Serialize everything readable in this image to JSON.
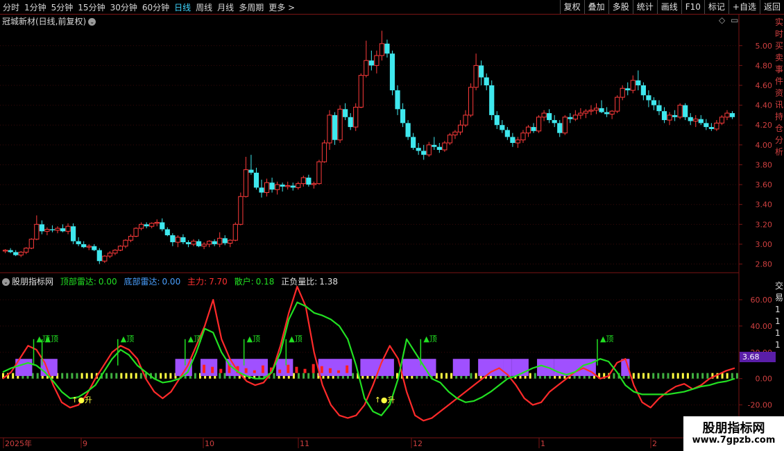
{
  "toolbar": {
    "periods": [
      "分时",
      "1分钟",
      "5分钟",
      "15分钟",
      "30分钟",
      "60分钟",
      "日线",
      "周线",
      "月线",
      "多周期",
      "更多 >"
    ],
    "active_period": "日线",
    "buttons": [
      "复权",
      "叠加",
      "多股",
      "统计",
      "画线",
      "F10",
      "标记",
      "+自选",
      "返回"
    ]
  },
  "stock": {
    "title": "冠城新材(日线,前复权)"
  },
  "indicator": {
    "name": "股朋指标网",
    "top_radar_label": "顶部雷达:",
    "top_radar_value": "0.00",
    "bottom_radar_label": "底部雷达:",
    "bottom_radar_value": "0.00",
    "main_label": "主力:",
    "main_value": "7.70",
    "retail_label": "散户:",
    "retail_value": "0.18",
    "ratio_label": "正负量比:",
    "ratio_value": "1.38",
    "current_value_tag": "3.68",
    "signal_top": "▲顶",
    "signal_rise": "↑●升"
  },
  "right_strip_text": "实时买卖 事件 资讯 持仓 分析",
  "right_strip_lower": "交易1111",
  "watermark": {
    "line1": "股朋指标网",
    "line2": "www.7gpzb.com"
  },
  "colors": {
    "up": "#ff3b3b",
    "down": "#3fe8ee",
    "main": "#ff2a2a",
    "retail": "#22e022",
    "block": "#a050ff",
    "bar_yellow": "#ffff40",
    "bar_green": "#40b040",
    "axis": "#7a1414",
    "tick_label": "#d04040"
  },
  "chart_data": [
    {
      "type": "candlestick",
      "title": "冠城新材(日线,前复权)",
      "ylim": [
        2.72,
        5.18
      ],
      "y_ticks": [
        "5.00",
        "4.80",
        "4.60",
        "4.40",
        "4.20",
        "4.00",
        "3.80",
        "3.60",
        "3.40",
        "3.20",
        "3.00",
        "2.80"
      ],
      "x_labels": [
        "2025年",
        "9",
        "10",
        "11",
        "12",
        "1",
        "2"
      ],
      "candles": [
        [
          2.93,
          2.95,
          2.91,
          2.94
        ],
        [
          2.94,
          2.96,
          2.91,
          2.92
        ],
        [
          2.92,
          2.94,
          2.88,
          2.89
        ],
        [
          2.89,
          2.93,
          2.87,
          2.92
        ],
        [
          2.92,
          2.97,
          2.9,
          2.96
        ],
        [
          2.96,
          3.06,
          2.95,
          3.05
        ],
        [
          3.05,
          3.29,
          3.04,
          3.2
        ],
        [
          3.2,
          3.24,
          3.1,
          3.13
        ],
        [
          3.13,
          3.17,
          3.09,
          3.15
        ],
        [
          3.15,
          3.19,
          3.12,
          3.14
        ],
        [
          3.14,
          3.18,
          3.11,
          3.16
        ],
        [
          3.16,
          3.2,
          3.12,
          3.13
        ],
        [
          3.13,
          3.21,
          3.1,
          3.18
        ],
        [
          3.18,
          3.21,
          3.0,
          3.03
        ],
        [
          3.03,
          3.07,
          2.98,
          3.0
        ],
        [
          3.0,
          3.03,
          2.96,
          2.97
        ],
        [
          2.97,
          3.0,
          2.94,
          2.98
        ],
        [
          2.98,
          3.0,
          2.93,
          2.94
        ],
        [
          2.94,
          2.96,
          2.8,
          2.83
        ],
        [
          2.83,
          2.89,
          2.81,
          2.88
        ],
        [
          2.88,
          2.93,
          2.86,
          2.91
        ],
        [
          2.91,
          2.95,
          2.89,
          2.94
        ],
        [
          2.94,
          2.99,
          2.93,
          2.98
        ],
        [
          2.98,
          3.05,
          2.96,
          3.04
        ],
        [
          3.04,
          3.1,
          3.02,
          3.08
        ],
        [
          3.08,
          3.17,
          3.07,
          3.16
        ],
        [
          3.16,
          3.22,
          3.14,
          3.2
        ],
        [
          3.2,
          3.22,
          3.16,
          3.18
        ],
        [
          3.18,
          3.22,
          3.16,
          3.21
        ],
        [
          3.21,
          3.25,
          3.18,
          3.22
        ],
        [
          3.22,
          3.26,
          3.13,
          3.15
        ],
        [
          3.15,
          3.17,
          3.08,
          3.09
        ],
        [
          3.09,
          3.11,
          2.98,
          3.02
        ],
        [
          3.02,
          3.09,
          2.97,
          3.07
        ],
        [
          3.07,
          3.1,
          3.0,
          3.02
        ],
        [
          3.02,
          3.04,
          2.97,
          3.0
        ],
        [
          3.0,
          3.05,
          2.98,
          3.03
        ],
        [
          3.03,
          3.05,
          2.97,
          2.98
        ],
        [
          2.98,
          3.02,
          2.95,
          3.0
        ],
        [
          3.0,
          3.04,
          2.97,
          3.03
        ],
        [
          3.03,
          3.05,
          2.98,
          3.0
        ],
        [
          3.0,
          3.12,
          2.97,
          3.06
        ],
        [
          3.06,
          3.09,
          2.99,
          3.01
        ],
        [
          3.01,
          3.05,
          2.97,
          3.04
        ],
        [
          3.04,
          3.22,
          3.03,
          3.2
        ],
        [
          3.2,
          3.52,
          3.19,
          3.48
        ],
        [
          3.48,
          3.88,
          3.47,
          3.75
        ],
        [
          3.75,
          3.9,
          3.7,
          3.72
        ],
        [
          3.72,
          3.77,
          3.55,
          3.57
        ],
        [
          3.57,
          3.65,
          3.47,
          3.52
        ],
        [
          3.52,
          3.66,
          3.48,
          3.62
        ],
        [
          3.62,
          3.67,
          3.52,
          3.55
        ],
        [
          3.55,
          3.63,
          3.5,
          3.6
        ],
        [
          3.6,
          3.62,
          3.53,
          3.58
        ],
        [
          3.58,
          3.63,
          3.55,
          3.59
        ],
        [
          3.59,
          3.62,
          3.54,
          3.57
        ],
        [
          3.57,
          3.63,
          3.55,
          3.61
        ],
        [
          3.61,
          3.69,
          3.58,
          3.67
        ],
        [
          3.67,
          3.7,
          3.58,
          3.6
        ],
        [
          3.6,
          3.63,
          3.56,
          3.61
        ],
        [
          3.61,
          3.85,
          3.6,
          3.83
        ],
        [
          3.83,
          4.05,
          3.82,
          4.02
        ],
        [
          4.02,
          4.35,
          3.95,
          4.3
        ],
        [
          4.3,
          4.33,
          4.0,
          4.05
        ],
        [
          4.05,
          4.4,
          4.02,
          4.36
        ],
        [
          4.36,
          4.42,
          4.25,
          4.28
        ],
        [
          4.28,
          4.32,
          4.15,
          4.18
        ],
        [
          4.18,
          4.42,
          4.14,
          4.38
        ],
        [
          4.38,
          4.72,
          4.37,
          4.7
        ],
        [
          4.7,
          5.05,
          4.68,
          4.85
        ],
        [
          4.85,
          4.95,
          4.75,
          4.8
        ],
        [
          4.8,
          4.95,
          4.72,
          4.9
        ],
        [
          4.9,
          5.15,
          4.85,
          5.02
        ],
        [
          5.02,
          5.06,
          4.88,
          4.92
        ],
        [
          4.92,
          4.95,
          4.5,
          4.55
        ],
        [
          4.55,
          4.6,
          4.3,
          4.36
        ],
        [
          4.36,
          4.42,
          4.18,
          4.22
        ],
        [
          4.22,
          4.25,
          4.05,
          4.08
        ],
        [
          4.08,
          4.12,
          3.95,
          3.97
        ],
        [
          3.97,
          4.02,
          3.9,
          3.94
        ],
        [
          3.94,
          4.0,
          3.85,
          3.9
        ],
        [
          3.9,
          4.03,
          3.88,
          4.0
        ],
        [
          4.0,
          4.08,
          3.95,
          3.98
        ],
        [
          3.98,
          4.02,
          3.92,
          3.95
        ],
        [
          3.95,
          4.04,
          3.93,
          4.02
        ],
        [
          4.02,
          4.12,
          4.0,
          4.1
        ],
        [
          4.1,
          4.15,
          4.06,
          4.13
        ],
        [
          4.13,
          4.25,
          4.1,
          4.2
        ],
        [
          4.2,
          4.35,
          4.18,
          4.3
        ],
        [
          4.3,
          4.62,
          4.28,
          4.58
        ],
        [
          4.58,
          4.92,
          4.55,
          4.8
        ],
        [
          4.8,
          4.85,
          4.6,
          4.68
        ],
        [
          4.68,
          4.72,
          4.55,
          4.6
        ],
        [
          4.6,
          4.65,
          4.25,
          4.3
        ],
        [
          4.3,
          4.34,
          4.16,
          4.2
        ],
        [
          4.2,
          4.25,
          4.12,
          4.15
        ],
        [
          4.15,
          4.18,
          4.05,
          4.08
        ],
        [
          4.08,
          4.12,
          3.98,
          4.02
        ],
        [
          4.02,
          4.08,
          3.97,
          4.05
        ],
        [
          4.05,
          4.15,
          4.02,
          4.12
        ],
        [
          4.12,
          4.2,
          4.08,
          4.18
        ],
        [
          4.18,
          4.22,
          4.12,
          4.14
        ],
        [
          4.14,
          4.3,
          4.12,
          4.28
        ],
        [
          4.28,
          4.35,
          4.24,
          4.32
        ],
        [
          4.32,
          4.36,
          4.22,
          4.25
        ],
        [
          4.25,
          4.3,
          4.18,
          4.22
        ],
        [
          4.22,
          4.25,
          4.08,
          4.12
        ],
        [
          4.12,
          4.3,
          4.1,
          4.28
        ],
        [
          4.28,
          4.32,
          4.22,
          4.26
        ],
        [
          4.26,
          4.35,
          4.24,
          4.3
        ],
        [
          4.3,
          4.37,
          4.26,
          4.32
        ],
        [
          4.32,
          4.36,
          4.27,
          4.34
        ],
        [
          4.34,
          4.4,
          4.3,
          4.35
        ],
        [
          4.35,
          4.42,
          4.31,
          4.37
        ],
        [
          4.37,
          4.45,
          4.32,
          4.33
        ],
        [
          4.33,
          4.38,
          4.28,
          4.31
        ],
        [
          4.31,
          4.35,
          4.26,
          4.34
        ],
        [
          4.34,
          4.5,
          4.32,
          4.48
        ],
        [
          4.48,
          4.6,
          4.45,
          4.57
        ],
        [
          4.57,
          4.63,
          4.5,
          4.55
        ],
        [
          4.55,
          4.7,
          4.52,
          4.65
        ],
        [
          4.65,
          4.75,
          4.55,
          4.6
        ],
        [
          4.6,
          4.63,
          4.45,
          4.5
        ],
        [
          4.5,
          4.55,
          4.38,
          4.45
        ],
        [
          4.45,
          4.48,
          4.35,
          4.4
        ],
        [
          4.4,
          4.45,
          4.3,
          4.34
        ],
        [
          4.34,
          4.38,
          4.22,
          4.25
        ],
        [
          4.25,
          4.33,
          4.2,
          4.3
        ],
        [
          4.3,
          4.35,
          4.24,
          4.28
        ],
        [
          4.28,
          4.42,
          4.26,
          4.4
        ],
        [
          4.4,
          4.42,
          4.25,
          4.28
        ],
        [
          4.28,
          4.32,
          4.2,
          4.24
        ],
        [
          4.24,
          4.3,
          4.18,
          4.26
        ],
        [
          4.26,
          4.3,
          4.2,
          4.22
        ],
        [
          4.22,
          4.26,
          4.15,
          4.18
        ],
        [
          4.18,
          4.22,
          4.14,
          4.16
        ],
        [
          4.16,
          4.25,
          4.14,
          4.22
        ],
        [
          4.22,
          4.3,
          4.2,
          4.28
        ],
        [
          4.28,
          4.35,
          4.25,
          4.32
        ],
        [
          4.32,
          4.34,
          4.26,
          4.28
        ]
      ]
    },
    {
      "type": "line",
      "title": "股朋指标网",
      "ylim": [
        -35,
        70
      ],
      "y_ticks": [
        "60.00",
        "40.00",
        "20.00",
        "0.00",
        "-20.00"
      ],
      "series": [
        {
          "name": "主力",
          "values": [
            0,
            5,
            15,
            25,
            22,
            12,
            -5,
            -18,
            -22,
            -20,
            -12,
            0,
            10,
            20,
            25,
            22,
            15,
            0,
            -10,
            -15,
            -10,
            0,
            10,
            25,
            40,
            60,
            30,
            15,
            5,
            -2,
            -5,
            -3,
            5,
            25,
            50,
            70,
            55,
            20,
            -5,
            -20,
            -28,
            -30,
            -28,
            -20,
            -5,
            12,
            25,
            15,
            -10,
            -28,
            -32,
            -30,
            -25,
            -20,
            -15,
            -10,
            -5,
            0,
            5,
            8,
            3,
            -5,
            -15,
            -20,
            -18,
            -10,
            -5,
            0,
            5,
            8,
            5,
            0,
            2,
            12,
            15,
            -5,
            -18,
            -22,
            -15,
            -10,
            -6,
            -4,
            -8,
            -5,
            0,
            3,
            6,
            8
          ]
        },
        {
          "name": "散户",
          "values": [
            5,
            8,
            10,
            12,
            10,
            5,
            -2,
            -10,
            -15,
            -14,
            -10,
            -5,
            5,
            15,
            22,
            18,
            10,
            5,
            0,
            -3,
            -2,
            0,
            5,
            20,
            38,
            35,
            20,
            10,
            5,
            2,
            0,
            0,
            5,
            20,
            45,
            58,
            55,
            50,
            48,
            45,
            40,
            30,
            10,
            -15,
            -25,
            -28,
            -20,
            0,
            30,
            20,
            10,
            0,
            -3,
            -10,
            -15,
            -18,
            -17,
            -14,
            -10,
            -5,
            0,
            2,
            5,
            8,
            10,
            8,
            5,
            3,
            5,
            10,
            12,
            15,
            13,
            5,
            -5,
            -10,
            -12,
            -12,
            -12,
            -12,
            -11,
            -10,
            -8,
            -6,
            -5,
            -3,
            -2,
            0
          ]
        }
      ],
      "block_spans": [
        [
          2,
          3
        ],
        [
          5,
          6
        ],
        [
          21,
          22
        ],
        [
          24,
          25
        ],
        [
          27,
          31
        ],
        [
          33,
          34
        ],
        [
          38,
          41
        ],
        [
          43,
          46
        ],
        [
          48,
          51
        ],
        [
          54,
          55
        ],
        [
          57,
          59
        ],
        [
          60,
          60
        ],
        [
          61,
          62
        ],
        [
          64,
          65
        ],
        [
          66,
          70
        ],
        [
          74,
          74
        ]
      ],
      "top_signals": [
        4,
        5,
        14,
        22,
        29,
        34,
        50,
        71
      ],
      "rise_signals": [
        9,
        45
      ]
    }
  ]
}
